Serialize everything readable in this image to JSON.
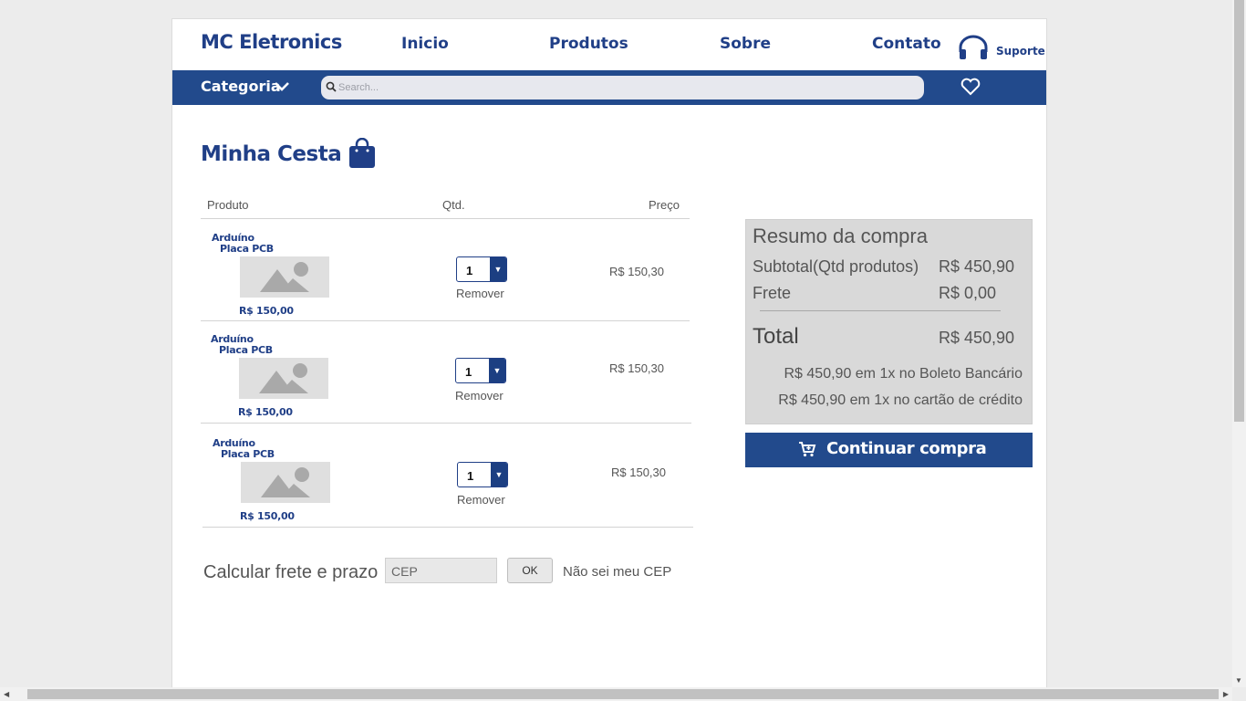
{
  "header": {
    "brand": "MC Eletronics",
    "nav": [
      "Inicio",
      "Produtos",
      "Sobre",
      "Contato"
    ],
    "support_label": "Suporte"
  },
  "bar": {
    "category_label": "Categoria",
    "search_placeholder": "Search..."
  },
  "cart": {
    "title": "Minha Cesta",
    "columns": {
      "product": "Produto",
      "qty": "Qtd.",
      "price": "Preço"
    },
    "items": [
      {
        "name_line1": "Arduíno",
        "name_line2": "Placa PCB",
        "unit_price": "R$ 150,00",
        "qty": "1",
        "remove_label": "Remover",
        "line_price": "R$ 150,30"
      },
      {
        "name_line1": "Arduíno",
        "name_line2": "Placa PCB",
        "unit_price": "R$ 150,00",
        "qty": "1",
        "remove_label": "Remover",
        "line_price": "R$ 150,30"
      },
      {
        "name_line1": "Arduíno",
        "name_line2": "Placa PCB",
        "unit_price": "R$ 150,00",
        "qty": "1",
        "remove_label": "Remover",
        "line_price": "R$ 150,30"
      }
    ]
  },
  "shipping": {
    "label": "Calcular frete e prazo",
    "cep_placeholder": "CEP",
    "ok_label": "OK",
    "no_cep_link": "Não sei meu CEP"
  },
  "summary": {
    "title": "Resumo da compra",
    "subtotal_label": "Subtotal(Qtd produtos)",
    "subtotal_value": "R$ 450,90",
    "shipping_label": "Frete",
    "shipping_value": "R$ 0,00",
    "total_label": "Total",
    "total_value": "R$ 450,90",
    "installment_boleto": "R$ 450,90 em 1x no Boleto Bancário",
    "installment_card": "R$ 450,90 em 1x no cartão de crédito",
    "continue_label": "Continuar compra"
  },
  "colors": {
    "brand_blue": "#203f87",
    "bar_blue": "#224a8c"
  },
  "icons": [
    "headset-icon",
    "chevron-down-icon",
    "search-icon",
    "heart-icon",
    "shopping-bag-icon",
    "image-placeholder-icon",
    "cart-icon"
  ]
}
